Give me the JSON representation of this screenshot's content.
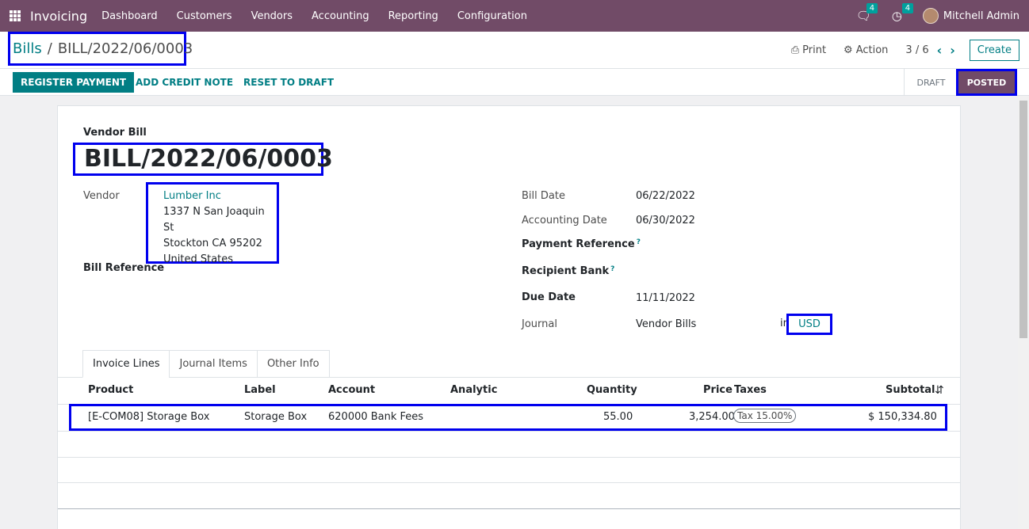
{
  "navbar": {
    "app_name": "Invoicing",
    "menu": [
      "Dashboard",
      "Customers",
      "Vendors",
      "Accounting",
      "Reporting",
      "Configuration"
    ],
    "messages_count": "4",
    "activities_count": "4",
    "user_name": "Mitchell Admin"
  },
  "breadcrumb": {
    "parent": "Bills",
    "separator": "/",
    "current": "BILL/2022/06/0003"
  },
  "controls": {
    "print": "Print",
    "action": "Action",
    "pager": "3 / 6",
    "create": "Create"
  },
  "statusbar": {
    "register_payment": "REGISTER PAYMENT",
    "add_credit_note": "ADD CREDIT NOTE",
    "reset_to_draft": "RESET TO DRAFT",
    "states": [
      "DRAFT",
      "POSTED"
    ],
    "active_state": "POSTED"
  },
  "form": {
    "doc_type": "Vendor Bill",
    "doc_name": "BILL/2022/06/0003",
    "vendor_label": "Vendor",
    "vendor_name": "Lumber Inc",
    "vendor_address": [
      "1337 N San Joaquin St",
      "Stockton CA 95202",
      "United States"
    ],
    "bill_reference_label": "Bill Reference",
    "bill_date_label": "Bill Date",
    "bill_date": "06/22/2022",
    "accounting_date_label": "Accounting Date",
    "accounting_date": "06/30/2022",
    "payment_reference_label": "Payment Reference",
    "recipient_bank_label": "Recipient Bank",
    "help_mark": "?",
    "due_date_label": "Due Date",
    "due_date": "11/11/2022",
    "journal_label": "Journal",
    "journal": "Vendor Bills",
    "in_text": "in",
    "currency": "USD"
  },
  "tabs": [
    "Invoice Lines",
    "Journal Items",
    "Other Info"
  ],
  "lines": {
    "headers": [
      "Product",
      "Label",
      "Account",
      "Analytic",
      "Quantity",
      "Price",
      "Taxes",
      "Subtotal"
    ],
    "rows": [
      {
        "product": "[E-COM08] Storage Box",
        "label": "Storage Box",
        "account": "620000 Bank Fees",
        "analytic": "",
        "quantity": "55.00",
        "price": "3,254.00",
        "tax": "Tax 15.00%",
        "subtotal": "$ 150,334.80"
      }
    ]
  }
}
